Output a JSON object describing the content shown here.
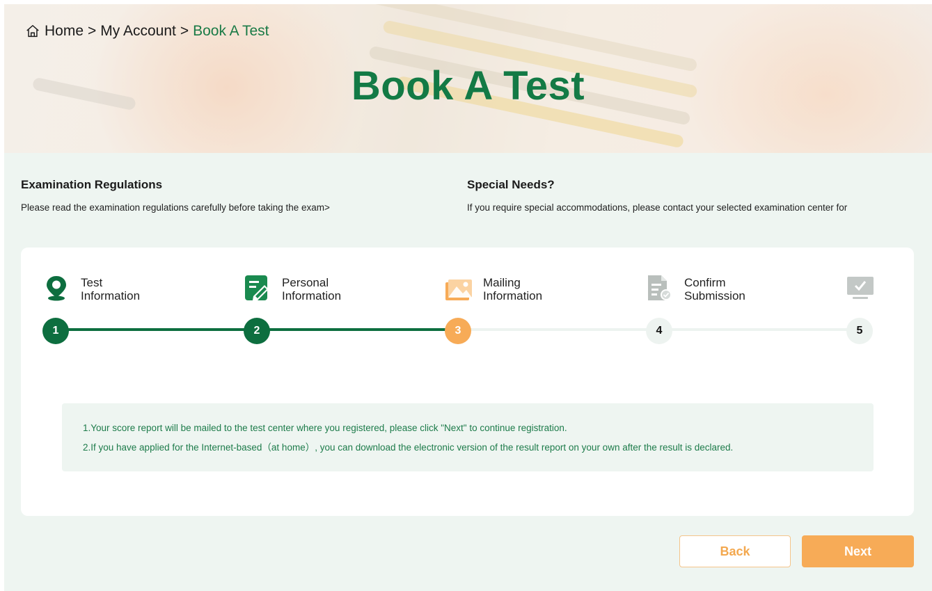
{
  "breadcrumb": {
    "home": "Home",
    "sep1": ">",
    "account": "My Account",
    "sep2": ">",
    "current": "Book A Test"
  },
  "hero": {
    "title": "Book A Test"
  },
  "info": {
    "regulations_title": "Examination Regulations",
    "regulations_text": "Please read the examination regulations carefully before taking the exam>",
    "special_title": "Special Needs?",
    "special_text": "If you require special accommodations, please contact your selected examination center for"
  },
  "steps": [
    {
      "line1": "Test",
      "line2": "Information",
      "number": "1",
      "icon": "location-pin-icon"
    },
    {
      "line1": "Personal",
      "line2": "Information",
      "number": "2",
      "icon": "edit-form-icon"
    },
    {
      "line1": "Mailing",
      "line2": "Information",
      "number": "3",
      "icon": "mail-image-icon"
    },
    {
      "line1": "Confirm",
      "line2": "Submission",
      "number": "4",
      "icon": "document-check-icon"
    },
    {
      "line1": "",
      "line2": "",
      "number": "5",
      "icon": "monitor-check-icon"
    }
  ],
  "current_step": 3,
  "notice": {
    "line1": "1.Your score report will be mailed to the test center where you registered, please click \"Next\" to continue registration.",
    "line2": "2.If you have applied for the Internet-based（at home）, you can download the electronic version of the result report on your own after the result is declared."
  },
  "buttons": {
    "back": "Back",
    "next": "Next"
  },
  "colors": {
    "brand_green": "#137a45",
    "accent_orange": "#f7ab57",
    "panel_bg": "#eef5f1"
  }
}
